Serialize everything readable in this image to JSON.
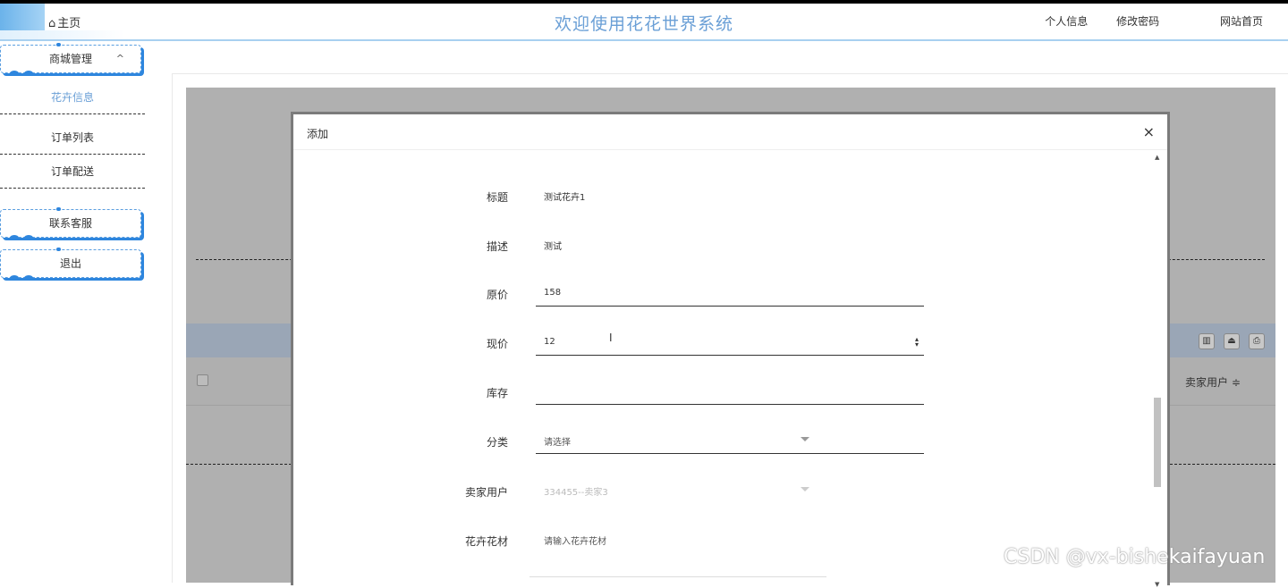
{
  "header": {
    "home": "主页",
    "title": "欢迎使用花花世界系统",
    "links": [
      "个人信息",
      "修改密码",
      "网站首页"
    ]
  },
  "sidebar": {
    "group": "商城管理",
    "items": [
      "花卉信息",
      "订单列表",
      "订单配送"
    ],
    "contact": "联系客服",
    "logout": "退出"
  },
  "table": {
    "column_seller": "卖家用户 ≑"
  },
  "dialog": {
    "title": "添加",
    "close": "×",
    "fields": {
      "title": {
        "label": "标题",
        "value": "测试花卉1"
      },
      "desc": {
        "label": "描述",
        "value": "测试"
      },
      "original_price": {
        "label": "原价",
        "value": "158"
      },
      "current_price": {
        "label": "现价",
        "value": "12"
      },
      "stock": {
        "label": "库存",
        "value": ""
      },
      "category": {
        "label": "分类",
        "placeholder": "请选择"
      },
      "seller": {
        "label": "卖家用户",
        "value": "334455--卖家3"
      },
      "material": {
        "label": "花卉花材",
        "placeholder": "请输入花卉花材"
      }
    }
  },
  "watermark": "CSDN @vx-bishekaifayuan"
}
